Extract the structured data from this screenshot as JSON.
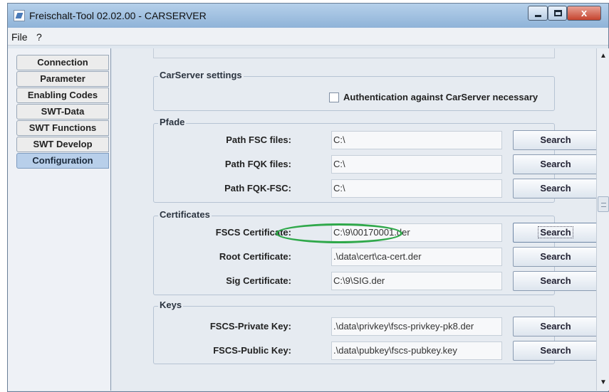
{
  "window": {
    "title": "Freischalt-Tool 02.02.00 - CARSERVER",
    "controls": {
      "close_glyph": "x"
    }
  },
  "menu": [
    "File",
    "?"
  ],
  "tabs": [
    {
      "label": "Connection",
      "active": false
    },
    {
      "label": "Parameter",
      "active": false
    },
    {
      "label": "Enabling Codes",
      "active": false
    },
    {
      "label": "SWT-Data",
      "active": false
    },
    {
      "label": "SWT Functions",
      "active": false
    },
    {
      "label": "SWT Develop",
      "active": false
    },
    {
      "label": "Configuration",
      "active": true
    }
  ],
  "carserver": {
    "title": "CarServer settings",
    "auth_label": "Authentication against CarServer necessary",
    "auth_checked": false
  },
  "pfade": {
    "title": "Pfade",
    "rows": [
      {
        "label": "Path FSC files:",
        "value": "C:\\",
        "button": "Search"
      },
      {
        "label": "Path FQK files:",
        "value": "C:\\",
        "button": "Search"
      },
      {
        "label": "Path FQK-FSC:",
        "value": "C:\\",
        "button": "Search"
      }
    ]
  },
  "certificates": {
    "title": "Certificates",
    "rows": [
      {
        "label": "FSCS Certificate:",
        "value": "C:\\9\\00170001.der",
        "button": "Search"
      },
      {
        "label": "Root Certificate:",
        "value": ".\\data\\cert\\ca-cert.der",
        "button": "Search"
      },
      {
        "label": "Sig Certificate:",
        "value": "C:\\9\\SIG.der",
        "button": "Search"
      }
    ]
  },
  "keys": {
    "title": "Keys",
    "rows": [
      {
        "label": "FSCS-Private Key:",
        "value": ".\\data\\privkey\\fscs-privkey-pk8.der",
        "button": "Search"
      },
      {
        "label": "FSCS-Public Key:",
        "value": ".\\data\\pubkey\\fscs-pubkey.key",
        "button": "Search"
      }
    ]
  },
  "colors": {
    "active_tab": "#b8cfea",
    "highlight": "#2fa84a"
  }
}
